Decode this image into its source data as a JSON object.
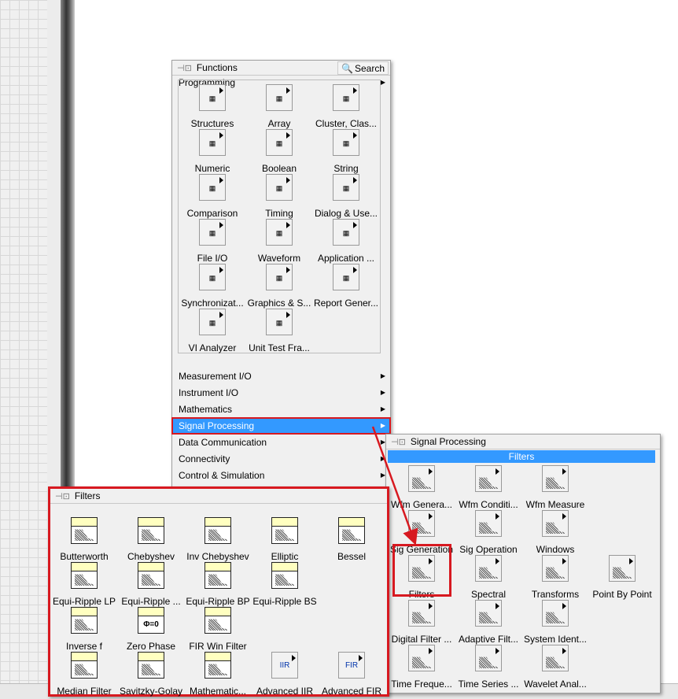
{
  "functions_palette": {
    "title": "Functions",
    "search_label": "Search",
    "top_category": "Programming",
    "programming_items": [
      "Structures",
      "Array",
      "Cluster, Clas...",
      "Numeric",
      "Boolean",
      "String",
      "Comparison",
      "Timing",
      "Dialog & Use...",
      "File I/O",
      "Waveform",
      "Application ...",
      "Synchronizat...",
      "Graphics & S...",
      "Report Gener...",
      "VI Analyzer",
      "Unit Test Fra..."
    ],
    "categories": [
      "Measurement I/O",
      "Instrument I/O",
      "Mathematics",
      "Signal Processing",
      "Data Communication",
      "Connectivity",
      "Control & Simulation"
    ],
    "selected_category": "Signal Processing"
  },
  "signal_processing_palette": {
    "title": "Signal Processing",
    "section": "Filters",
    "items": [
      "Wfm Genera...",
      "Wfm Conditi...",
      "Wfm Measure",
      "",
      "Sig Generation",
      "Sig Operation",
      "Windows",
      "",
      "Filters",
      "Spectral",
      "Transforms",
      "Point By Point",
      "Digital Filter ...",
      "Adaptive Filt...",
      "System Ident...",
      "",
      "Time Freque...",
      "Time Series ...",
      "Wavelet Anal...",
      ""
    ],
    "highlighted_item": "Filters"
  },
  "filters_palette": {
    "title": "Filters",
    "items": [
      "Butterworth",
      "Chebyshev",
      "Inv Chebyshev",
      "Elliptic",
      "Bessel",
      "Equi-Ripple LP",
      "Equi-Ripple ...",
      "Equi-Ripple BP",
      "Equi-Ripple BS",
      "",
      "Inverse f",
      "Zero Phase",
      "FIR Win Filter",
      "",
      "",
      "Median Filter",
      "Savitzky-Golay",
      "Mathematic...",
      "Advanced IIR",
      "Advanced FIR"
    ]
  },
  "colors": {
    "highlight": "#3399ff",
    "annotation": "#d71920"
  }
}
